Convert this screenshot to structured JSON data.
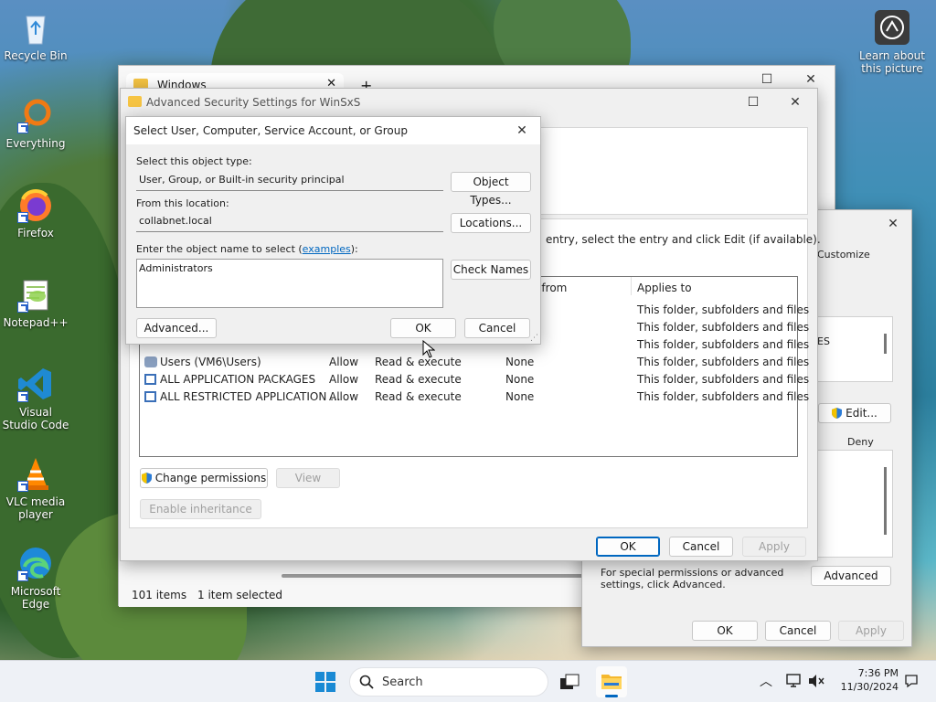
{
  "desktop": {
    "icons": [
      {
        "label": "Recycle Bin"
      },
      {
        "label": "Everything"
      },
      {
        "label": "Firefox"
      },
      {
        "label": "Notepad++"
      },
      {
        "label": "Visual Studio Code"
      },
      {
        "label": "VLC media player"
      },
      {
        "label": "Microsoft Edge"
      }
    ],
    "learn_label": "Learn about this picture"
  },
  "explorer": {
    "tab_title": "Windows",
    "new_tab": "+",
    "status_items": "101 items",
    "status_selected": "1 item selected"
  },
  "adv_security": {
    "title": "Advanced Security Settings for WinSxS",
    "instruction": "entry, select the entry and click Edit (if available).",
    "columns": {
      "inherited": "d from",
      "applies": "Applies to"
    },
    "rows": [
      {
        "principal": "",
        "access": "",
        "type": "",
        "inherited": "",
        "applies": "This folder, subfolders and files"
      },
      {
        "principal": "",
        "access": "",
        "type": "",
        "inherited": "",
        "applies": "This folder, subfolders and files"
      },
      {
        "principal": "",
        "access": "",
        "type": "",
        "inherited": "",
        "applies": "This folder, subfolders and files"
      },
      {
        "principal": "Users (VM6\\Users)",
        "type": "Allow",
        "access": "Read & execute",
        "inherited": "None",
        "applies": "This folder, subfolders and files"
      },
      {
        "principal": "ALL APPLICATION PACKAGES",
        "type": "Allow",
        "access": "Read & execute",
        "inherited": "None",
        "applies": "This folder, subfolders and files"
      },
      {
        "principal": "ALL RESTRICTED APPLICATION ...",
        "type": "Allow",
        "access": "Read & execute",
        "inherited": "None",
        "applies": "This folder, subfolders and files"
      }
    ],
    "change_permissions": "Change permissions",
    "view": "View",
    "enable_inheritance": "Enable inheritance",
    "ok": "OK",
    "cancel": "Cancel",
    "apply": "Apply"
  },
  "properties": {
    "customize_tab": "Customize",
    "list_fragment": "ES",
    "edit": "Edit...",
    "deny": "Deny",
    "special_text": "For special permissions or advanced settings, click Advanced.",
    "advanced": "Advanced",
    "ok": "OK",
    "cancel": "Cancel",
    "apply": "Apply"
  },
  "select_dialog": {
    "title": "Select User, Computer, Service Account, or Group",
    "object_type_label": "Select this object type:",
    "object_type_value": "User, Group, or Built-in security principal",
    "object_types_btn": "Object Types...",
    "location_label": "From this location:",
    "location_value": "collabnet.local",
    "locations_btn": "Locations...",
    "name_label_pre": "Enter the object name to select (",
    "name_label_link": "examples",
    "name_label_post": "):",
    "name_value": "Administrators",
    "check_names_btn": "Check Names",
    "advanced_btn": "Advanced...",
    "ok": "OK",
    "cancel": "Cancel"
  },
  "taskbar": {
    "search_placeholder": "Search",
    "time": "7:36 PM",
    "date": "11/30/2024"
  },
  "colors": {
    "accent": "#0067c0",
    "link": "#0067c0",
    "taskbar": "#eef1f6"
  }
}
